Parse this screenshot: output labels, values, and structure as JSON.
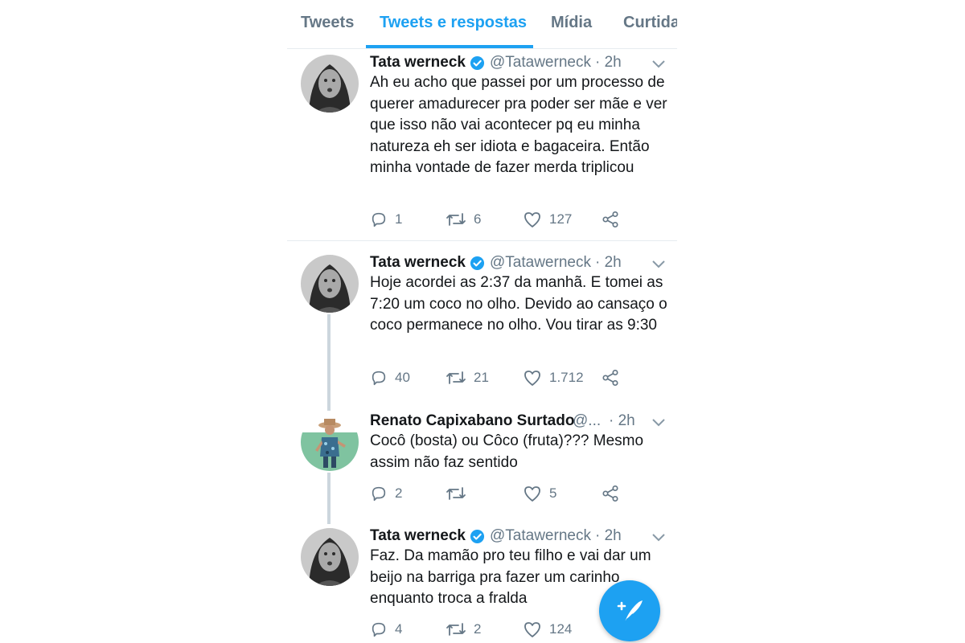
{
  "tabs": [
    {
      "label": "Tweets"
    },
    {
      "label": "Tweets e respostas"
    },
    {
      "label": "Mídia"
    },
    {
      "label": "Curtida"
    }
  ],
  "tweets": [
    {
      "name": "Tata werneck",
      "verified": true,
      "handle": "@Tatawerneck",
      "time": "· 2h",
      "text": "Ah eu acho que passei por um processo de querer amadurecer pra poder ser mãe e ver que isso não vai acontecer pq eu minha natureza eh ser idiota e bagaceira. Então minha vontade de fazer merda triplicou",
      "replies": "1",
      "retweets": "6",
      "likes": "127",
      "avatar": "tata-avatar"
    },
    {
      "name": "Tata werneck",
      "verified": true,
      "handle": "@Tatawerneck",
      "time": "· 2h",
      "text": "Hoje acordei as 2:37 da manhã. E tomei as 7:20 um coco no olho. Devido ao cansaço o coco permanece no olho. Vou tirar as 9:30",
      "replies": "40",
      "retweets": "21",
      "likes": "1.712",
      "avatar": "tata-avatar"
    },
    {
      "name": "Renato Capixabano Surtado",
      "verified": false,
      "handle": "@...",
      "time": "· 2h",
      "text": "Cocô (bosta) ou Côco (fruta)??? Mesmo assim não faz sentido",
      "replies": "2",
      "retweets": "",
      "likes": "5",
      "avatar": "renato-avatar"
    },
    {
      "name": "Tata werneck",
      "verified": true,
      "handle": "@Tatawerneck",
      "time": "· 2h",
      "text": "Faz. Da mamão pro teu filho e vai dar um beijo na barriga pra fazer um carinho enquanto troca a fralda",
      "replies": "4",
      "retweets": "2",
      "likes": "124",
      "avatar": "tata-avatar"
    }
  ],
  "colors": {
    "accent": "#1da1f2",
    "text": "#14171a",
    "muted": "#657786",
    "divider": "#e6ecf0",
    "thread": "#ccd6dd"
  },
  "icons": {
    "reply": "reply-icon",
    "retweet": "retweet-icon",
    "like": "heart-icon",
    "share": "share-icon",
    "verified": "verified-badge-icon",
    "more": "chevron-down-icon",
    "compose": "compose-tweet-icon"
  }
}
